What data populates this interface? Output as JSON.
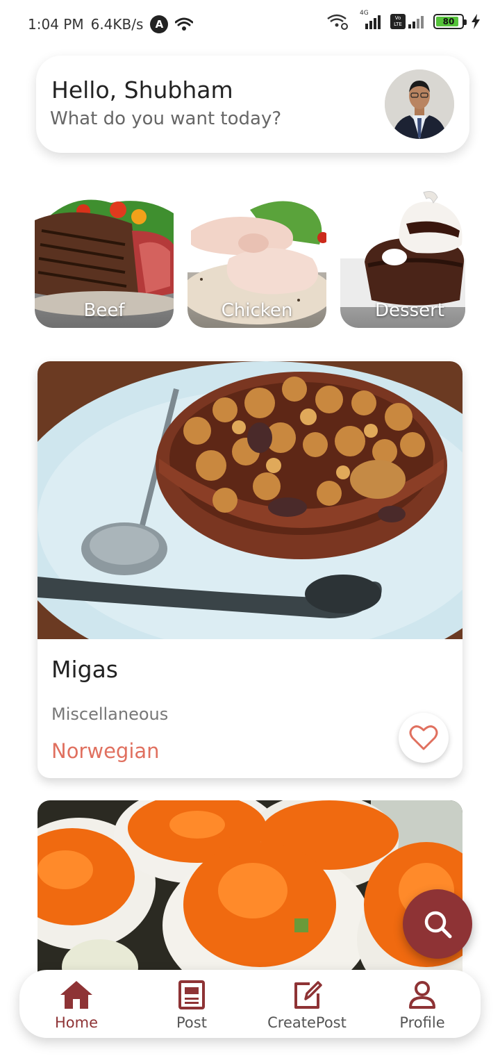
{
  "status_bar": {
    "time": "1:04 PM",
    "speed": "6.4KB/s",
    "badge": "A",
    "battery": "80",
    "net_label": "4G",
    "lte_label": "Vo LTE"
  },
  "greeting": {
    "title": "Hello, Shubham",
    "subtitle": "What do you want today?"
  },
  "categories": [
    {
      "label": "Beef",
      "icon": "beef-image"
    },
    {
      "label": "Chicken",
      "icon": "chicken-image"
    },
    {
      "label": "Dessert",
      "icon": "dessert-image"
    }
  ],
  "recipes": [
    {
      "name": "Migas",
      "category": "Miscellaneous",
      "area": "Norwegian",
      "image": "migas-dish-image",
      "favorite": false
    },
    {
      "name": "",
      "category": "",
      "area": "",
      "image": "sushi-image"
    }
  ],
  "fab": {
    "icon": "search-icon"
  },
  "bottom_nav": {
    "items": [
      {
        "label": "Home",
        "icon": "home-icon",
        "active": true
      },
      {
        "label": "Post",
        "icon": "post-icon",
        "active": false
      },
      {
        "label": "CreatePost",
        "icon": "create-post-icon",
        "active": false
      },
      {
        "label": "Profile",
        "icon": "profile-icon",
        "active": false
      }
    ]
  },
  "colors": {
    "accent": "#8e3335",
    "area_text": "#e0705f"
  }
}
